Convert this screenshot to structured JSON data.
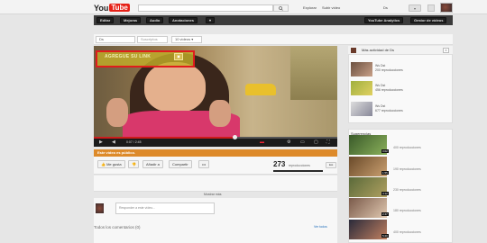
{
  "header": {
    "logo_text": "You",
    "logo_tube": "Tube",
    "search_placeholder": "",
    "links": [
      "Explorar",
      "Subir vídeo",
      "Ds"
    ],
    "menu_label": "▾"
  },
  "channel_bar": {
    "buttons": [
      "Editar",
      "Mejoras",
      "Audio",
      "Anotaciones",
      "▾"
    ],
    "right_buttons": [
      "YouTube Analytics",
      "Gestor de vídeos"
    ]
  },
  "strip": {
    "owner": "Ds",
    "subscribe": "Suscriptos",
    "videos": "10 videos ▾"
  },
  "video": {
    "annotation_text": "AGREGUE SU LINK",
    "annotation_icon": "▣",
    "time": "0:07 / 2:45",
    "progress": 0.58
  },
  "privacy_text": "Este vídeo es público.",
  "actions": {
    "like": "Me gusta",
    "dislike": "",
    "add": "Añadir a",
    "share": "Compartir",
    "more": "•••",
    "views": "273",
    "views_label": "reproducciones",
    "stats": "Est"
  },
  "details": {
    "show_more": "Mostrar más"
  },
  "comments": {
    "placeholder": "Responder a este vídeo...",
    "count_label": "Todos los comentarios (0)",
    "view_all": "Ver todos"
  },
  "activity": {
    "header": "Más actividad de Ds",
    "close": "✕",
    "items": [
      {
        "line1": "Ws Dst",
        "line2": "200 reproducciones"
      },
      {
        "line1": "Ws Dst",
        "line2": "456 reproducciones"
      },
      {
        "line1": "Ws Dst",
        "line2": "677 reproducciones"
      }
    ]
  },
  "suggestions": {
    "header": "Sugerencias",
    "items": [
      {
        "views": "400 reproducciones",
        "duration": "3:02"
      },
      {
        "views": "190 reproducciones",
        "duration": "1:55"
      },
      {
        "views": "230 reproducciones",
        "duration": "4:12"
      },
      {
        "views": "180 reproducciones",
        "duration": "2:47"
      },
      {
        "views": "400 reproducciones",
        "duration": "5:20"
      }
    ]
  },
  "colors": {
    "youtube_red": "#e62117",
    "privacy_orange": "#dd8a2a",
    "annotation_border": "#e01c1c"
  }
}
